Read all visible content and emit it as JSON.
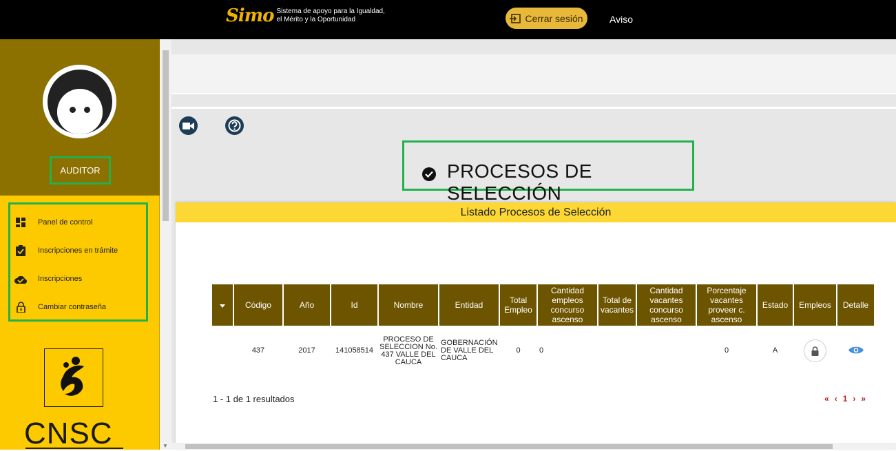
{
  "header": {
    "logo_mark": "Simo",
    "logo_line1": "Sistema de apoyo para la Igualdad,",
    "logo_line2": "el Mérito y la Oportunidad",
    "logout_label": "Cerrar sesión",
    "notice_label": "Aviso"
  },
  "sidebar": {
    "role": "AUDITOR",
    "items": [
      {
        "label": "Panel de control",
        "icon": "dashboard-icon"
      },
      {
        "label": "Inscripciones en trámite",
        "icon": "clipboard-check-icon"
      },
      {
        "label": "Inscripciones",
        "icon": "cloud-check-icon"
      },
      {
        "label": "Cambiar contraseña",
        "icon": "lock-icon"
      }
    ],
    "org_name": "CNSC"
  },
  "main": {
    "page_title": "PROCESOS DE SELECCIÓN",
    "panel_title": "Listado Procesos de Selección",
    "table": {
      "headers": [
        "Código",
        "Año",
        "Id",
        "Nombre",
        "Entidad",
        "Total Empleo",
        "Cantidad empleos concurso ascenso",
        "Total de vacantes",
        "Cantidad vacantes concurso ascenso",
        "Porcentaje vacantes proveer c. ascenso",
        "Estado",
        "Empleos",
        "Detalle"
      ],
      "rows": [
        {
          "codigo": "437",
          "anio": "2017",
          "id": "141058514",
          "nombre": "PROCESO DE SELECCION No. 437 VALLE DEL CAUCA",
          "entidad": "GOBERNACIÓN DE VALLE DEL CAUCA",
          "total_empleo": "0",
          "cant_empleos_ascenso": "0",
          "total_vacantes": "",
          "cant_vacantes_ascenso": "",
          "porcentaje": "0",
          "estado": "A"
        }
      ]
    },
    "results_text": "1 - 1 de 1 resultados",
    "pager": {
      "first": "«",
      "prev": "‹",
      "page": "1",
      "next": "›",
      "last": "»"
    }
  },
  "colors": {
    "topbar": "#000000",
    "sidebar_top": "#8c7000",
    "sidebar": "#fdca00",
    "table_header": "#6d5400",
    "panel_header": "#fdd835",
    "highlight_box": "#22b14c"
  }
}
